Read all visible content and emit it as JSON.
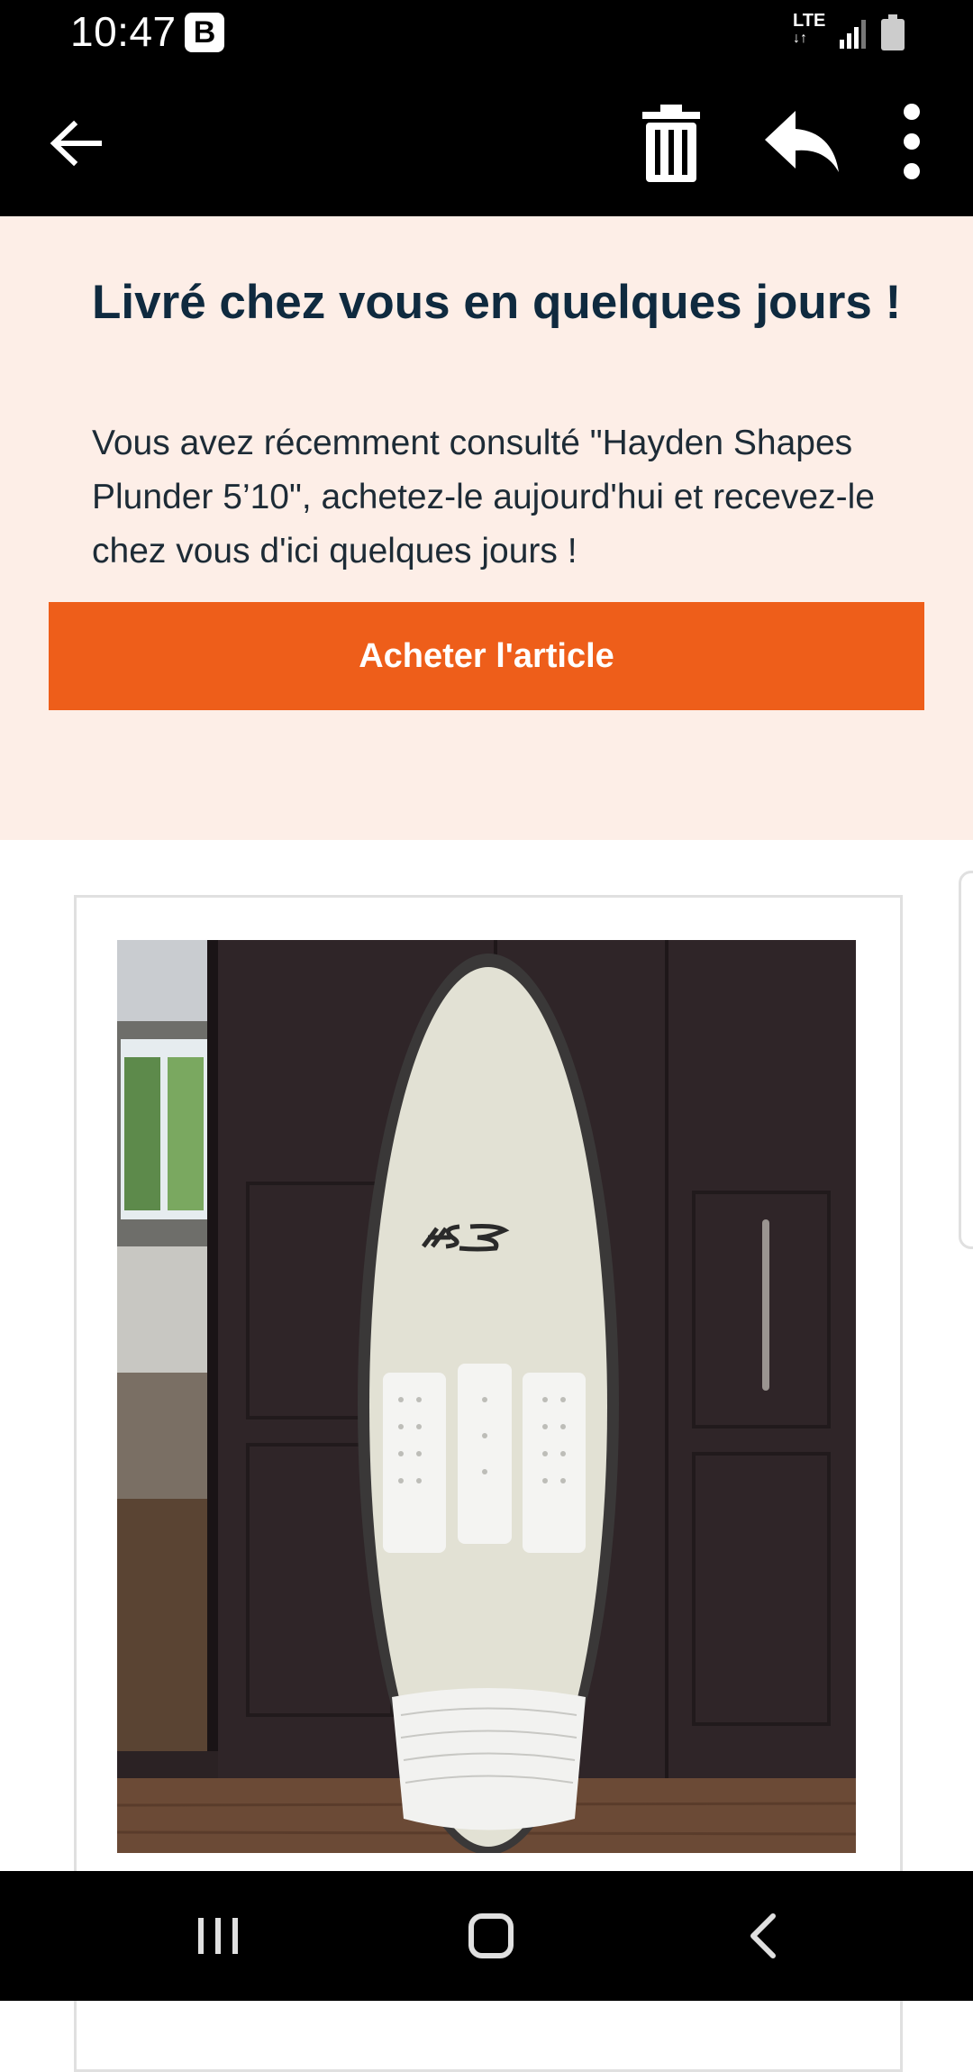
{
  "status_bar": {
    "time": "10:47",
    "notification_badge": "B",
    "network": "LTE",
    "icons": [
      "lte-icon",
      "signal-icon",
      "battery-icon"
    ]
  },
  "app_bar": {
    "icons": [
      "back-arrow-icon",
      "trash-icon",
      "reply-icon",
      "more-vert-icon"
    ]
  },
  "promo": {
    "title": "Livré chez vous en quelques jours !",
    "body": "Vous avez récemment consulté \"Hayden Shapes Plunder 5’10\", achetez-le aujourd'hui et recevez-le chez vous d'ici quelques jours !",
    "button_label": "Acheter l'article"
  },
  "product": {
    "image_alt": "surfboard-photo"
  },
  "nav_bar": {
    "icons": [
      "recent-apps-icon",
      "home-icon",
      "back-icon"
    ]
  },
  "colors": {
    "promo_bg": "#fdeee7",
    "accent": "#ee5e1a",
    "title": "#0f2a3f"
  }
}
